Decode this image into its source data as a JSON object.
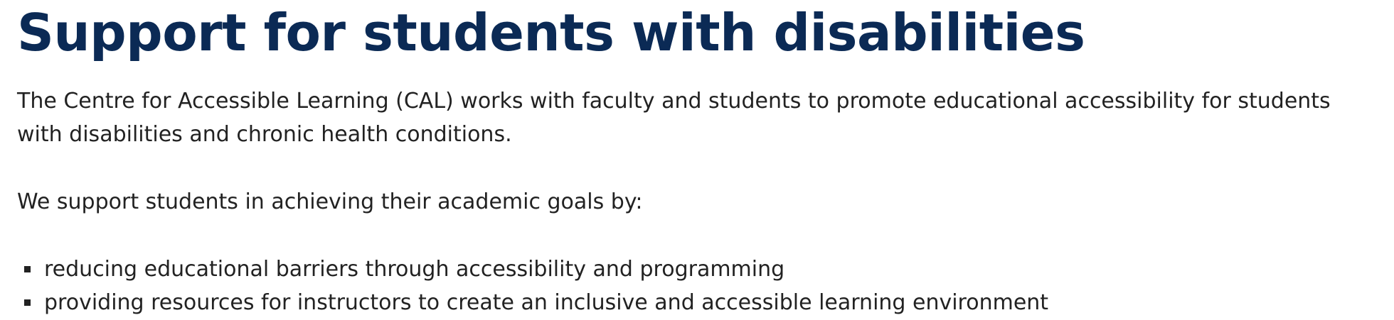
{
  "page": {
    "title": "Support for students with disabilities",
    "intro": "The Centre for Accessible Learning (CAL) works with faculty and students to promote educational accessibility for students with disabilities and chronic health conditions.",
    "lead": "We support students in achieving their academic goals by:",
    "bullets": [
      "reducing educational barriers through accessibility and programming",
      "providing resources for instructors to create an inclusive and accessible learning environment"
    ]
  },
  "colors": {
    "heading": "#0b2a55",
    "text": "#222222"
  }
}
